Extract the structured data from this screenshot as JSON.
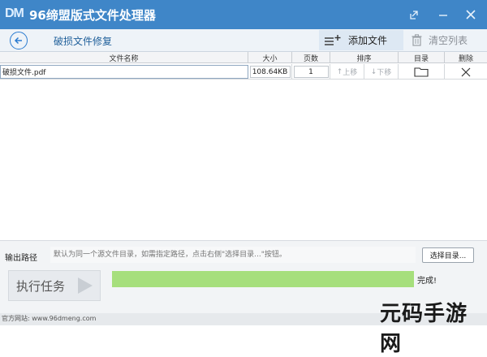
{
  "window": {
    "logo_text": "DM",
    "title": "96缔盟版式文件处理器",
    "controls": {
      "maximize_icon": "maximize-icon",
      "minimize_icon": "minimize-icon",
      "close_icon": "close-icon"
    }
  },
  "toolbar": {
    "back_icon": "back-arrow-icon",
    "page_title": "破损文件修复",
    "add_file_label": "添加文件",
    "clear_list_label": "清空列表"
  },
  "table": {
    "columns": [
      "文件名称",
      "大小",
      "页数",
      "排序",
      "目录",
      "删除"
    ],
    "rows": [
      {
        "name": "破损文件.pdf",
        "size": "108.64KB",
        "pages": "1",
        "move_up": "上移",
        "move_down": "下移",
        "folder_icon": "folder-icon",
        "delete_icon": "delete-icon"
      }
    ]
  },
  "output": {
    "label": "输出路径",
    "placeholder": "默认为同一个源文件目录，如需指定路径，点击右侧\"选择目录...\"按钮。",
    "choose_label": "选择目录..."
  },
  "run": {
    "label": "执行任务",
    "progress_percent": 100,
    "status_text": "完成!"
  },
  "footer": {
    "website": "官方网站: www.96dmeng.com"
  },
  "watermark": "元码手游网",
  "colors": {
    "titlebar": "#3f86c8",
    "progress_fill": "#a6df7c",
    "accent": "#2a7bd0"
  }
}
